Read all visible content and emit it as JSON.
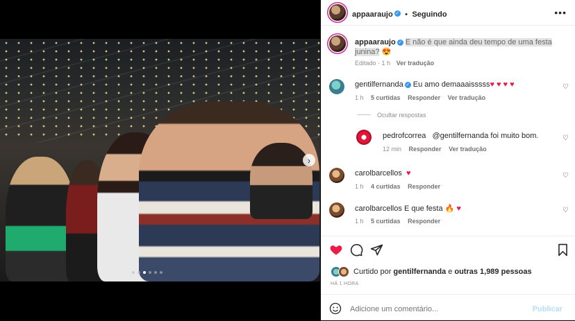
{
  "post": {
    "username": "appaaraujo",
    "follow_status": "Seguindo",
    "caption_plain": "E não é que ainda deu tempo de uma festa",
    "caption_line2": "junina?",
    "caption_emoji": "😍",
    "caption_meta_time": "Editado · 1 h",
    "caption_meta_translate": "Ver tradução"
  },
  "comments": [
    {
      "username": "gentilfernanda",
      "verified": true,
      "text": "Eu amo demaaaisssss",
      "hearts": "♥♥♥♥",
      "time": "1 h",
      "likes": "5 curtidas",
      "reply": "Responder",
      "translate": "Ver tradução"
    },
    {
      "username": "carolbarcellos",
      "text": "",
      "hearts": "♥",
      "time": "1 h",
      "likes": "4 curtidas",
      "reply": "Responder"
    },
    {
      "username": "carolbarcellos",
      "text": "E que festa",
      "emoji": "🔥",
      "hearts": "♥",
      "time": "1 h",
      "likes": "5 curtidas",
      "reply": "Responder"
    }
  ],
  "hide_replies": "Ocultar respostas",
  "reply": {
    "username": "pedrofcorrea",
    "mention": "@gentilfernanda",
    "text": "foi muito bom.",
    "time": "12 min",
    "reply": "Responder",
    "translate": "Ver tradução"
  },
  "likes": {
    "prefix": "Curtido por",
    "user": "gentilfernanda",
    "middle": "e",
    "others": "outras 1,989 pessoas"
  },
  "timestamp": "HÁ 1 HORA",
  "composer": {
    "placeholder": "Adicione um comentário...",
    "publish": "Publicar"
  },
  "carousel": {
    "next_glyph": "›",
    "dot_count": 6,
    "active_dot": 2
  },
  "colors": {
    "like_red": "#ed1c45",
    "verified_blue": "#3897f0",
    "publish_disabled": "#b2dffc"
  }
}
